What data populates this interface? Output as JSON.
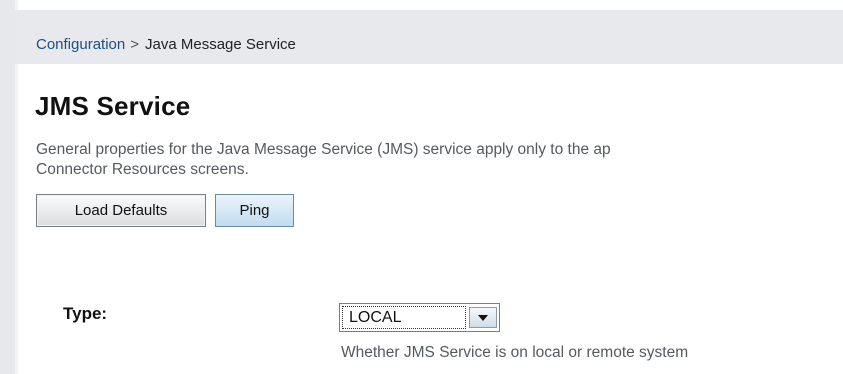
{
  "breadcrumb": {
    "parent": "Configuration",
    "separator": ">",
    "current": "Java Message Service"
  },
  "page": {
    "title": "JMS Service",
    "help_line1": "General properties for the Java Message Service (JMS) service apply only to the ap",
    "help_line2": "Connector Resources screens."
  },
  "buttons": {
    "load_defaults": "Load Defaults",
    "ping": "Ping"
  },
  "fields": {
    "type": {
      "label": "Type:",
      "value": "LOCAL",
      "help": "Whether JMS Service is on local or remote system"
    }
  },
  "colors": {
    "link": "#1a4f8a",
    "breadcrumb_bar": "#e8e9ed",
    "help_text": "#555a60",
    "ping_button": "#c2dcef"
  },
  "icons": {
    "dropdown": "chevron-down-icon"
  }
}
